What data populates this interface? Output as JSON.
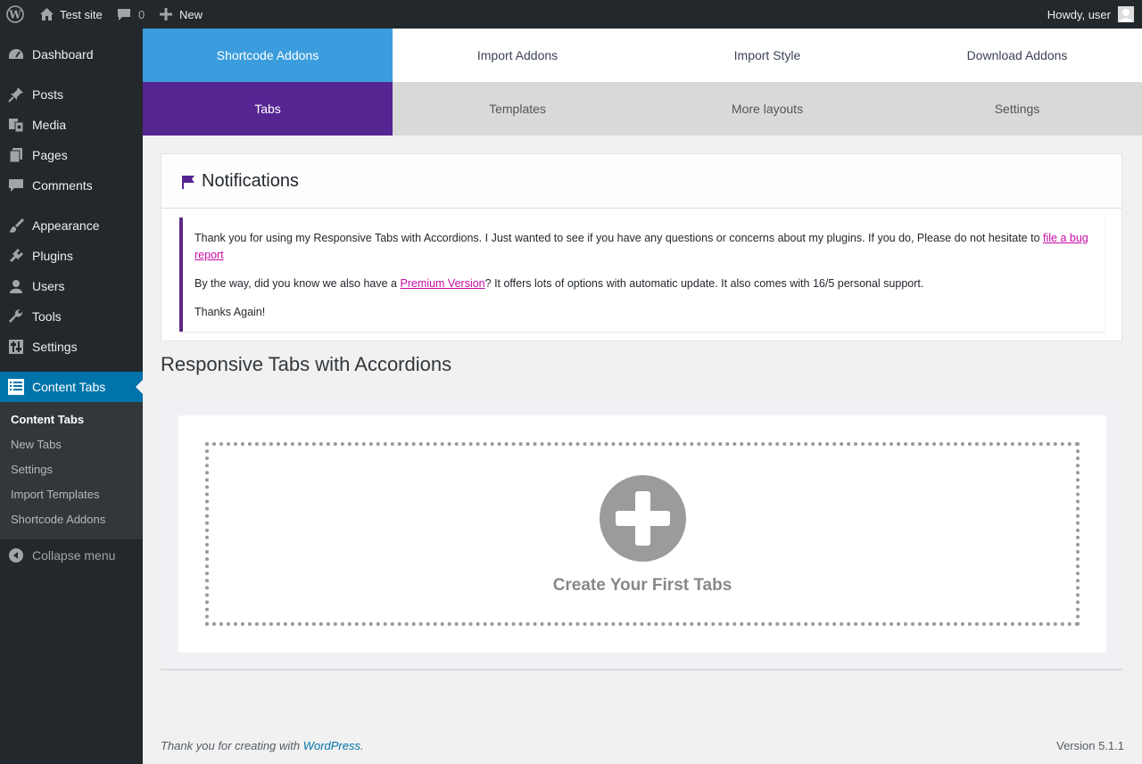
{
  "adminbar": {
    "site_name": "Test site",
    "comments_count": "0",
    "new_label": "New",
    "greeting": "Howdy, user"
  },
  "sidebar": {
    "items": [
      {
        "label": "Dashboard",
        "icon": "dashboard-icon"
      },
      {
        "label": "Posts",
        "icon": "pin-icon"
      },
      {
        "label": "Media",
        "icon": "media-icon"
      },
      {
        "label": "Pages",
        "icon": "pages-icon"
      },
      {
        "label": "Comments",
        "icon": "comment-icon"
      },
      {
        "label": "Appearance",
        "icon": "brush-icon"
      },
      {
        "label": "Plugins",
        "icon": "plugin-icon"
      },
      {
        "label": "Users",
        "icon": "user-icon"
      },
      {
        "label": "Tools",
        "icon": "wrench-icon"
      },
      {
        "label": "Settings",
        "icon": "settings-icon"
      },
      {
        "label": "Content Tabs",
        "icon": "list-icon"
      }
    ],
    "submenu": [
      "Content Tabs",
      "New Tabs",
      "Settings",
      "Import Templates",
      "Shortcode Addons"
    ],
    "collapse_label": "Collapse menu"
  },
  "nav": {
    "row1": [
      "Shortcode Addons",
      "Import Addons",
      "Import Style",
      "Download Addons"
    ],
    "row2": [
      "Tabs",
      "Templates",
      "More layouts",
      "Settings"
    ]
  },
  "notifications": {
    "title": "Notifications",
    "p1_text": "Thank you for using my Responsive Tabs with Accordions. I Just wanted to see if you have any questions or concerns about my plugins. If you do, Please do not hesitate to ",
    "p1_link": "file a bug report",
    "p2_before": "By the way, did you know we also have a ",
    "p2_link": "Premium Version",
    "p2_after": "? It offers lots of options with automatic update. It also comes with 16/5 personal support.",
    "p3": "Thanks Again!"
  },
  "main": {
    "heading": "Responsive Tabs with Accordions",
    "create_label": "Create Your First Tabs"
  },
  "footer": {
    "thanks_text": "Thank you for creating with ",
    "wp_link": "WordPress",
    "dot": ".",
    "version": "Version 5.1.1"
  },
  "colors": {
    "sidebar_bg": "#23282d",
    "active_menu": "#0073aa",
    "tab_selected_row1": "#3b9ddd",
    "tab_selected_row2": "#552592",
    "link_pink": "#c70ba6"
  }
}
